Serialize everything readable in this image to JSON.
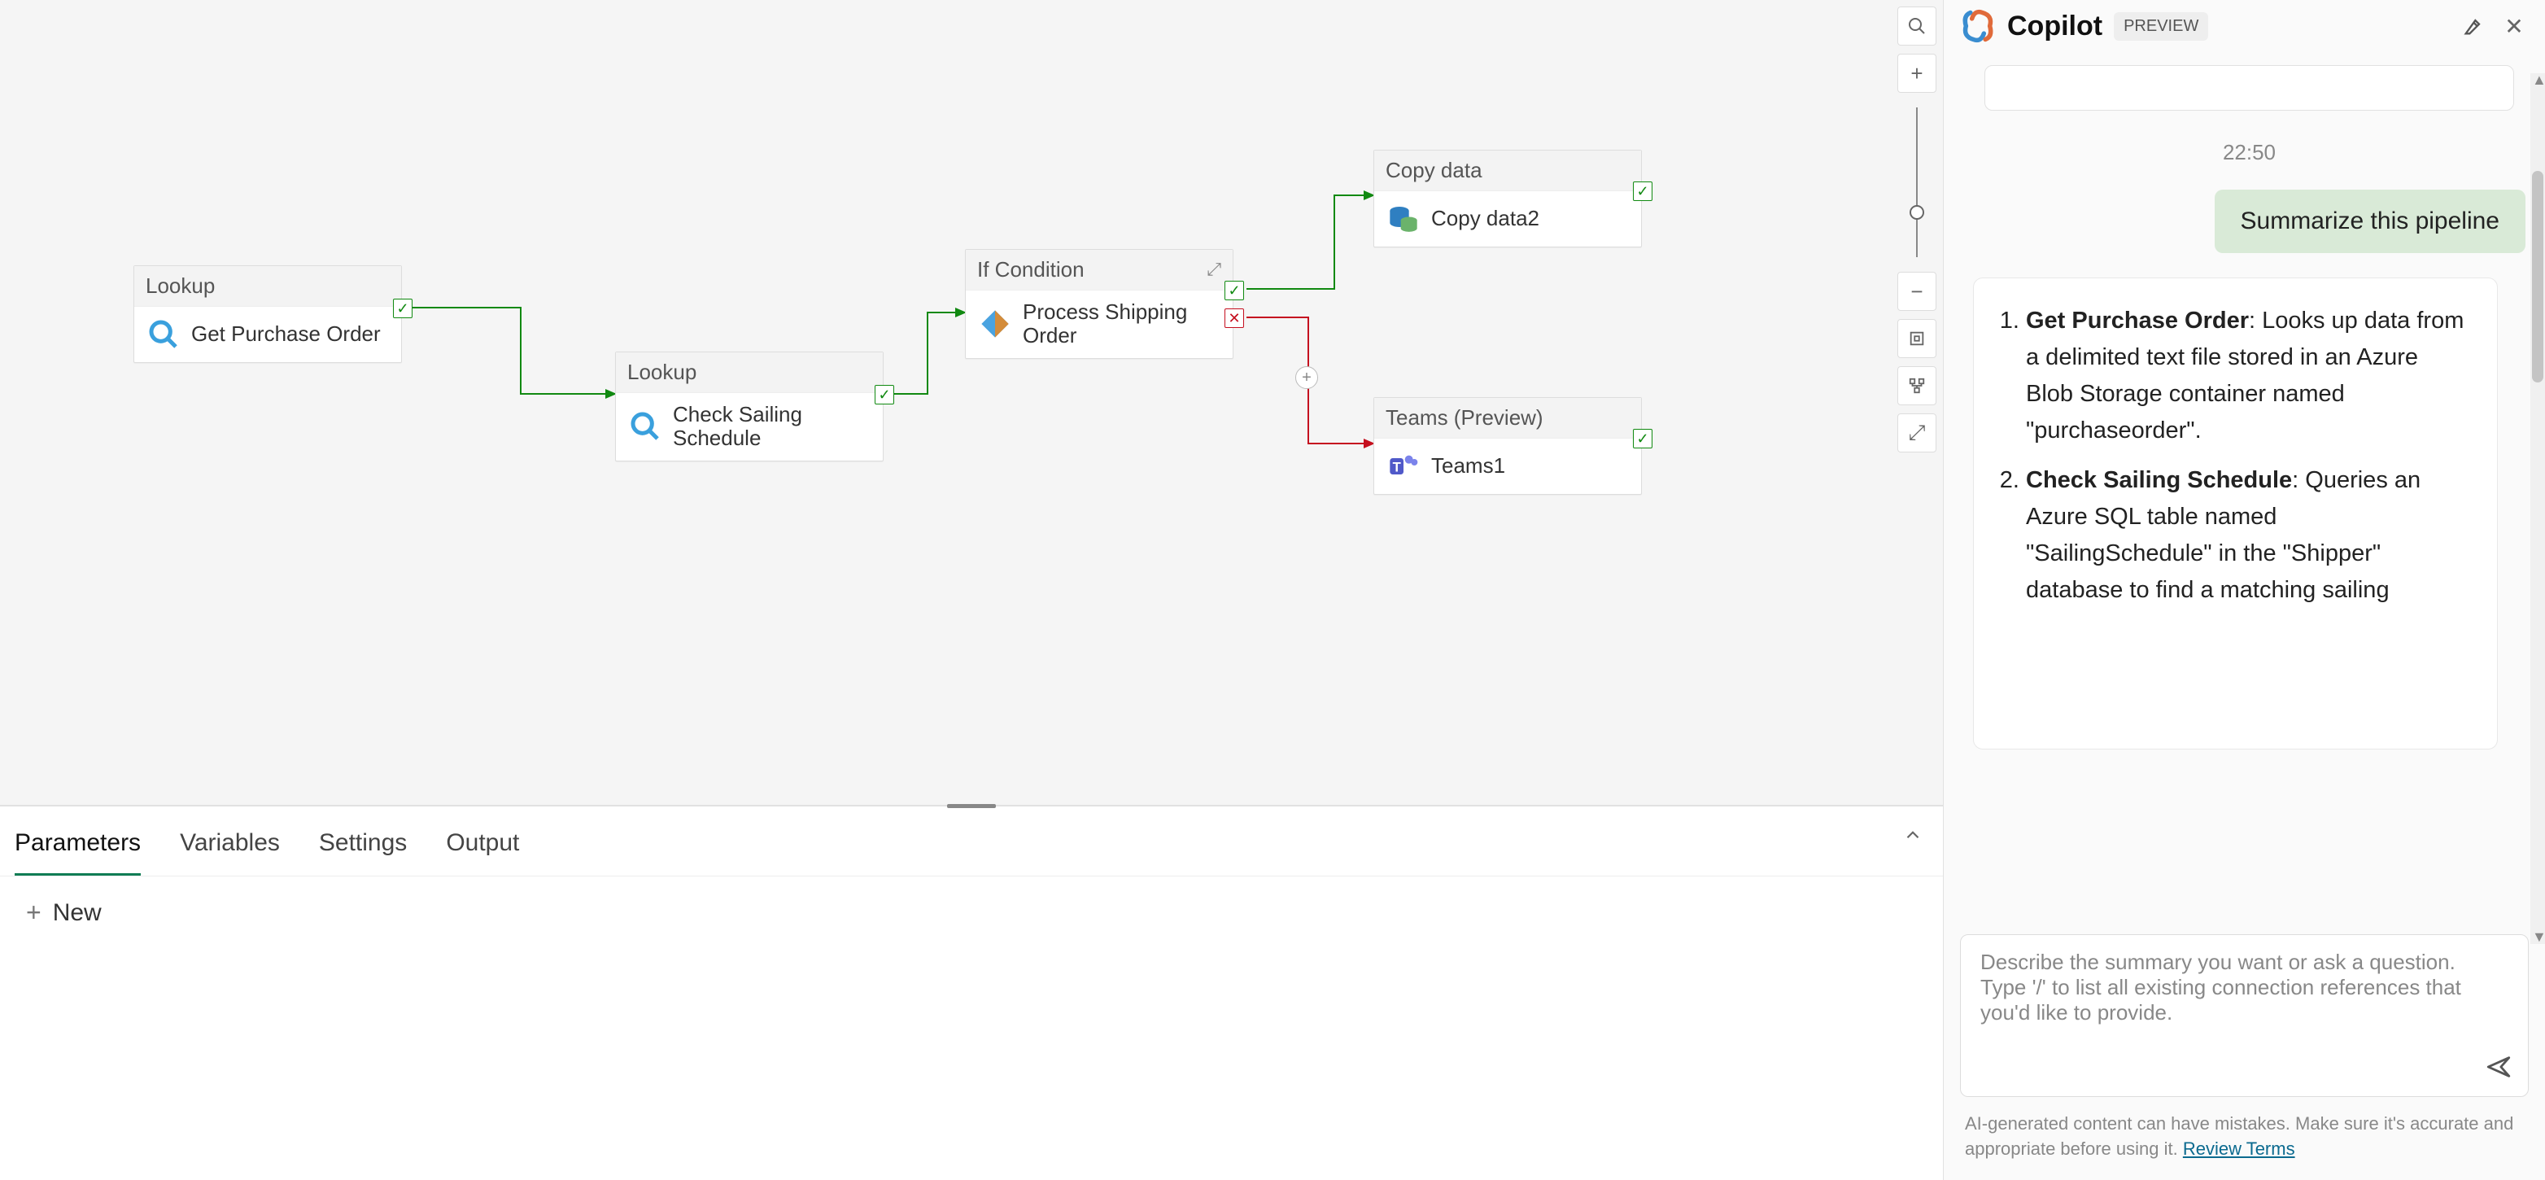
{
  "canvas": {
    "nodes": {
      "lookup1": {
        "type": "Lookup",
        "name": "Get Purchase Order"
      },
      "lookup2": {
        "type": "Lookup",
        "name": "Check Sailing Schedule"
      },
      "ifcond": {
        "type": "If Condition",
        "name": "Process Shipping Order"
      },
      "copy": {
        "type": "Copy data",
        "name": "Copy data2"
      },
      "teams": {
        "type": "Teams (Preview)",
        "name": "Teams1"
      }
    }
  },
  "bottom": {
    "tabs": [
      "Parameters",
      "Variables",
      "Settings",
      "Output"
    ],
    "activeTab": 0,
    "newLabel": "New"
  },
  "copilot": {
    "title": "Copilot",
    "badge": "PREVIEW",
    "timestamp": "22:50",
    "userMsg": "Summarize this pipeline",
    "response": {
      "item1_title": "Get Purchase Order",
      "item1_body": ": Looks up data from a delimited text file stored in an Azure Blob Storage container named \"purchaseorder\".",
      "item2_title": "Check Sailing Schedule",
      "item2_body": ": Queries an Azure SQL table named \"SailingSchedule\" in the \"Shipper\" database to find a matching sailing"
    },
    "placeholder": "Describe the summary you want or ask a question.\nType '/' to list all existing connection references that you'd like to provide.",
    "disclaimer": "AI-generated content can have mistakes. Make sure it's accurate and appropriate before using it. ",
    "disclaimerLink": "Review Terms"
  }
}
